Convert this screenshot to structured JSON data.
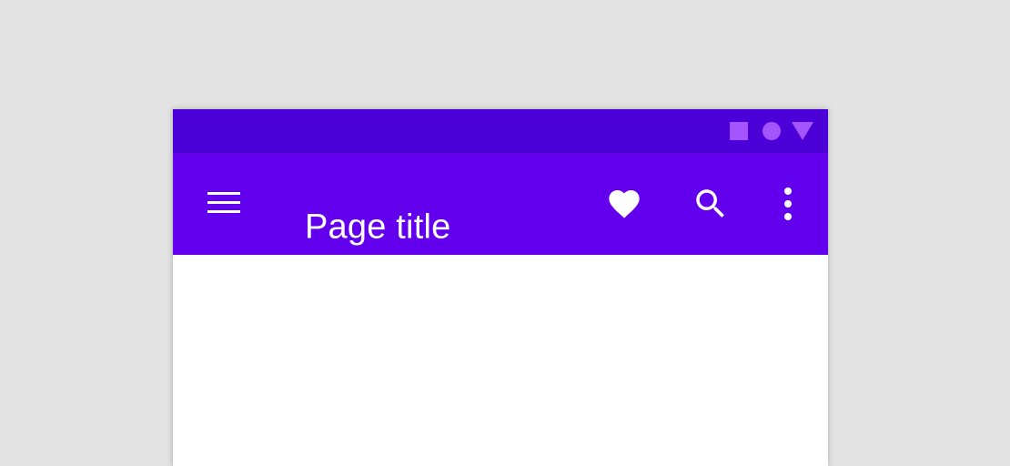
{
  "status_bar": {
    "icons": [
      "square-icon",
      "circle-icon",
      "triangle-icon"
    ],
    "background": "#4a00d6",
    "icon_color": "#a455ff"
  },
  "app_bar": {
    "title": "Page title",
    "background": "#6200ee",
    "navigation_icon": "menu-icon",
    "actions": [
      "favorite-icon",
      "search-icon",
      "more-vert-icon"
    ]
  },
  "colors": {
    "page_background": "#e3e3e3",
    "surface": "#ffffff",
    "on_primary": "#ffffff"
  }
}
